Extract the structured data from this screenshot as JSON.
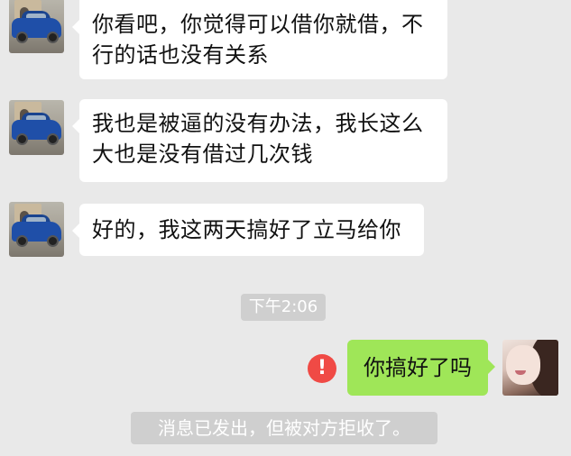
{
  "messages": [
    {
      "sender": "contact",
      "text": "你看吧，你觉得可以借你就借，不行的话也没有关系"
    },
    {
      "sender": "contact",
      "text": "我也是被逼的没有办法，我长这么大也是没有借过几次钱"
    },
    {
      "sender": "contact",
      "text": "好的，我这两天搞好了立马给你"
    },
    {
      "sender": "me",
      "text": "你搞好了吗"
    }
  ],
  "timestamp": "下午2:06",
  "error_icon": "!",
  "system_note": "消息已发出，但被对方拒收了。",
  "icons": {
    "contact_avatar": "car-photo-avatar",
    "my_avatar": "woman-photo-avatar",
    "error": "exclamation-circle-icon"
  },
  "colors": {
    "background": "#e9e9e9",
    "my_bubble": "#9fe658",
    "their_bubble": "#ffffff",
    "error": "#f04a45"
  }
}
